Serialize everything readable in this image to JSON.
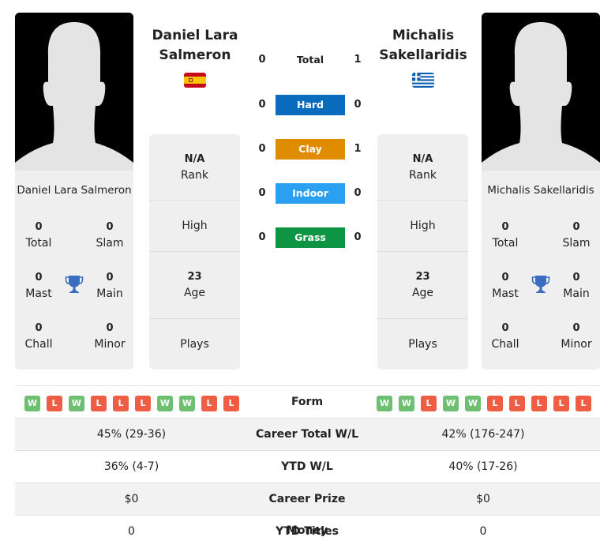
{
  "player1": {
    "name": "Daniel Lara Salmeron",
    "title_line1": "Daniel Lara",
    "title_line2": "Salmeron",
    "country": "Spain",
    "flag_icon": "spain-flag-icon",
    "stats": {
      "total": {
        "value": "0",
        "label": "Total"
      },
      "slam": {
        "value": "0",
        "label": "Slam"
      },
      "mast": {
        "value": "0",
        "label": "Mast"
      },
      "main": {
        "value": "0",
        "label": "Main"
      },
      "chall": {
        "value": "0",
        "label": "Chall"
      },
      "minor": {
        "value": "0",
        "label": "Minor"
      }
    },
    "info": {
      "rank": {
        "value": "N/A",
        "label": "Rank"
      },
      "high": {
        "value": "",
        "label": "High"
      },
      "age": {
        "value": "23",
        "label": "Age"
      },
      "plays": {
        "value": "",
        "label": "Plays"
      }
    },
    "form": [
      "W",
      "L",
      "W",
      "L",
      "L",
      "L",
      "W",
      "W",
      "L",
      "L"
    ],
    "career_total_wl": "45% (29-36)",
    "ytd_wl": "36% (4-7)",
    "career_prize_money": "$0",
    "ytd_titles": "0"
  },
  "player2": {
    "name": "Michalis Sakellaridis",
    "title_line1": "Michalis",
    "title_line2": "Sakellaridis",
    "country": "Greece",
    "flag_icon": "greece-flag-icon",
    "stats": {
      "total": {
        "value": "0",
        "label": "Total"
      },
      "slam": {
        "value": "0",
        "label": "Slam"
      },
      "mast": {
        "value": "0",
        "label": "Mast"
      },
      "main": {
        "value": "0",
        "label": "Main"
      },
      "chall": {
        "value": "0",
        "label": "Chall"
      },
      "minor": {
        "value": "0",
        "label": "Minor"
      }
    },
    "info": {
      "rank": {
        "value": "N/A",
        "label": "Rank"
      },
      "high": {
        "value": "",
        "label": "High"
      },
      "age": {
        "value": "23",
        "label": "Age"
      },
      "plays": {
        "value": "",
        "label": "Plays"
      }
    },
    "form": [
      "W",
      "W",
      "L",
      "W",
      "W",
      "L",
      "L",
      "L",
      "L",
      "L"
    ],
    "career_total_wl": "42% (176-247)",
    "ytd_wl": "40% (17-26)",
    "career_prize_money": "$0",
    "ytd_titles": "0"
  },
  "h2h": {
    "total": {
      "label": "Total",
      "p1": "0",
      "p2": "1"
    },
    "surfaces": [
      {
        "label": "Hard",
        "p1": "0",
        "p2": "0",
        "color": "#0b6bbd"
      },
      {
        "label": "Clay",
        "p1": "0",
        "p2": "1",
        "color": "#df8c00"
      },
      {
        "label": "Indoor",
        "p1": "0",
        "p2": "0",
        "color": "#2b9ff0"
      },
      {
        "label": "Grass",
        "p1": "0",
        "p2": "0",
        "color": "#0e9544"
      }
    ]
  },
  "table_labels": {
    "form": "Form",
    "career_total_wl": "Career Total W/L",
    "ytd_wl": "YTD W/L",
    "career_prize_money": "Career Prize Money",
    "ytd_titles": "YTD Titles"
  },
  "colors": {
    "win": "#6fbf73",
    "loss": "#ee5d44",
    "trophy": "#3a6dbf"
  }
}
